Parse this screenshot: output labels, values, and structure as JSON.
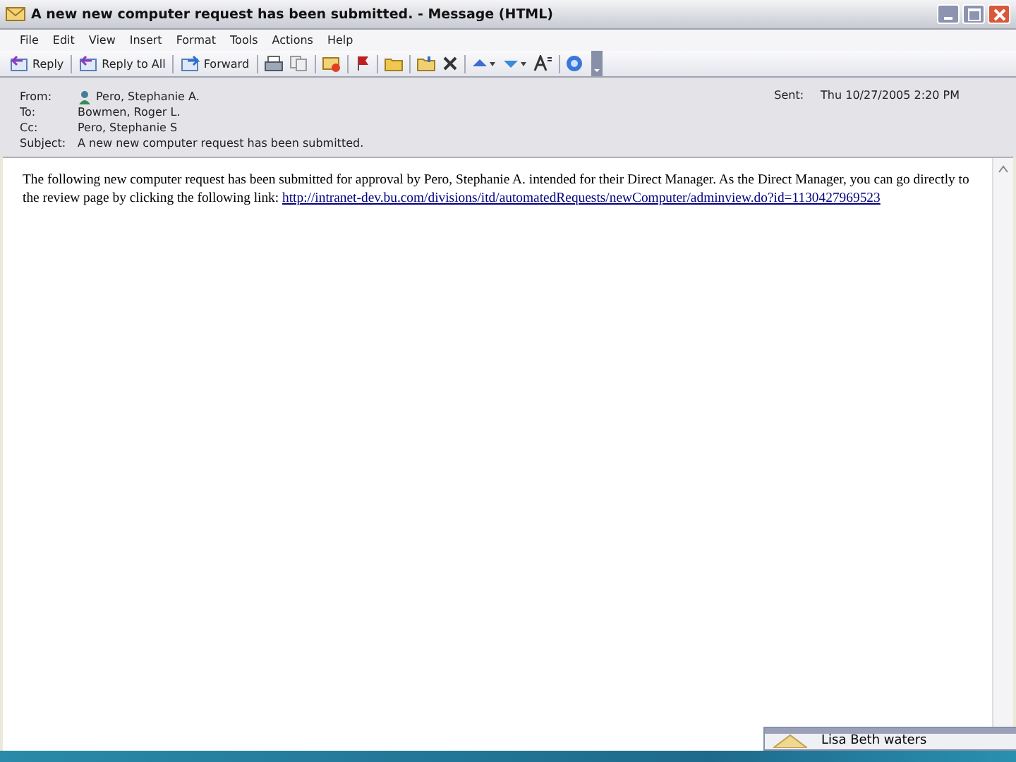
{
  "window": {
    "title": "A new new computer request has been submitted. - Message (HTML)"
  },
  "menu": [
    "File",
    "Edit",
    "View",
    "Insert",
    "Format",
    "Tools",
    "Actions",
    "Help"
  ],
  "toolbar": [
    {
      "label": "Reply"
    },
    {
      "label": "Reply to All"
    },
    {
      "label": "Forward"
    }
  ],
  "header": {
    "fields": [
      {
        "label": "From:",
        "value": "Pero, Stephanie A.",
        "kind": "person"
      },
      {
        "label": "To:",
        "value": "Bowmen, Roger L.",
        "kind": "plain"
      },
      {
        "label": "Cc:",
        "value": "Pero, Stephanie S",
        "kind": "plain"
      },
      {
        "label": "Subject:",
        "value": "A new new computer request has been submitted.",
        "kind": "plain"
      }
    ],
    "sent_label": "Sent:",
    "sent_value": "Thu 10/27/2005 2:20 PM"
  },
  "body": {
    "text": "The following new computer request has been submitted for approval by Pero, Stephanie A. intended for their Direct Manager. As the Direct Manager, you can go directly to the review page by clicking the following link: ",
    "link": "http://intranet-dev.bu.com/divisions/itd/automatedRequests/newComputer/adminview.do?id=1130427969523"
  },
  "notification": {
    "sender": "Lisa Beth waters"
  }
}
